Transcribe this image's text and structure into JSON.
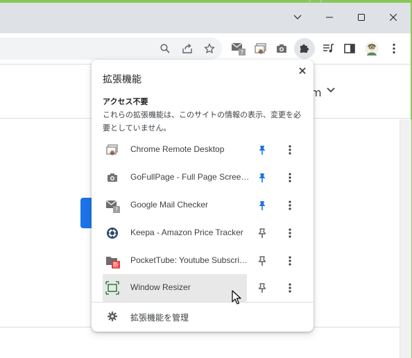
{
  "window": {
    "minimize_icon": "minimize-icon",
    "maximize_icon": "maximize-icon",
    "close_icon": "close-icon",
    "tab_search_icon": "chevron-down-icon"
  },
  "toolbar": {
    "icons": [
      "search-icon",
      "share-icon",
      "star-icon",
      "gmail-checker-icon",
      "chrome-remote-desktop-icon",
      "camera-icon",
      "extensions-puzzle-icon",
      "media-queue-icon",
      "side-panel-icon",
      "profile-avatar",
      "more-vert-icon"
    ],
    "gmail_badge": "?"
  },
  "page": {
    "partial_text": "m"
  },
  "popup": {
    "title": "拡張機能",
    "section_heading": "アクセス不要",
    "section_description": "これらの拡張機能は、このサイトの情報の表示、変更を必要としていません。",
    "extensions": [
      {
        "name": "Chrome Remote Desktop",
        "pinned": true,
        "icon": "chrome-remote-desktop-icon"
      },
      {
        "name": "GoFullPage - Full Page Screen…",
        "pinned": true,
        "icon": "camera-icon"
      },
      {
        "name": "Google Mail Checker",
        "pinned": true,
        "icon": "gmail-checker-icon"
      },
      {
        "name": "Keepa - Amazon Price Tracker",
        "pinned": false,
        "icon": "keepa-icon"
      },
      {
        "name": "PocketTube: Youtube Subscrip…",
        "pinned": false,
        "icon": "pockettube-icon",
        "badge": "新"
      },
      {
        "name": "Window Resizer",
        "pinned": false,
        "icon": "window-resizer-icon",
        "hovered": true
      }
    ],
    "manage_label": "拡張機能を管理"
  },
  "colors": {
    "pinned": "#1a73e8",
    "unpinned": "#5f6368",
    "titlebar": "#dee1e6",
    "frame_accent": "#8ac75a",
    "page_button": "#1a73e8"
  }
}
